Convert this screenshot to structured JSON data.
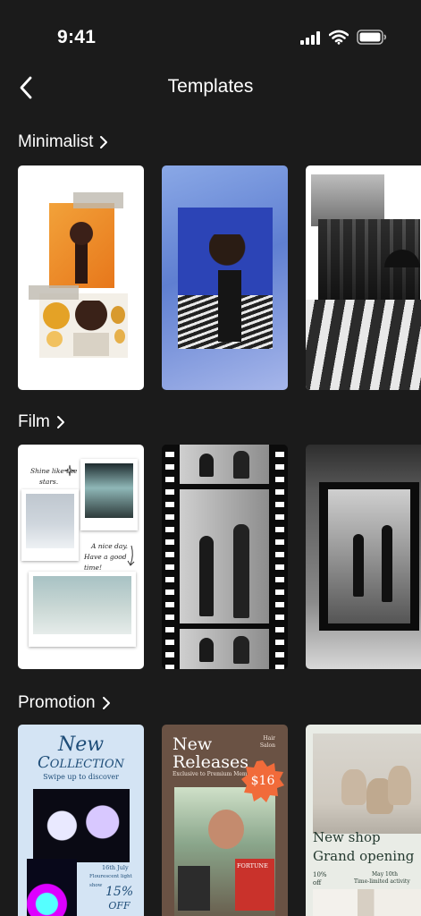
{
  "status_bar": {
    "time": "9:41"
  },
  "header": {
    "title": "Templates"
  },
  "sections": [
    {
      "name": "Minimalist"
    },
    {
      "name": "Film"
    },
    {
      "name": "Promotion"
    }
  ],
  "templates": {
    "film_1": {
      "text_1": "Shine like the",
      "text_2": "stars.",
      "text_3": "A nice day.",
      "text_4": "Have a good time!"
    },
    "promo_1": {
      "title_1": "New",
      "title_2": "Collection",
      "subtitle": "Swipe up to discover",
      "date": "16th July",
      "date_note": "Flourescent light show",
      "discount_1": "15%",
      "discount_2": "OFF"
    },
    "promo_2": {
      "title_1": "New",
      "title_2": "Releases",
      "note": "Exclusive to Premium Members",
      "salon_1": "Hair",
      "salon_2": "Salon",
      "price": "$16",
      "magazine": "FORTUNE"
    },
    "promo_3": {
      "title_1": "New shop",
      "title_2": "Grand opening",
      "discount_1": "10%",
      "discount_2": "off",
      "date": "May 10th",
      "date_note": "Time-limited activity"
    }
  },
  "colors": {
    "background": "#1b1b1b",
    "card_promo_blue": "#d4e4f4",
    "card_promo_brown": "#6a5244",
    "price_burst": "#f16b3a"
  }
}
